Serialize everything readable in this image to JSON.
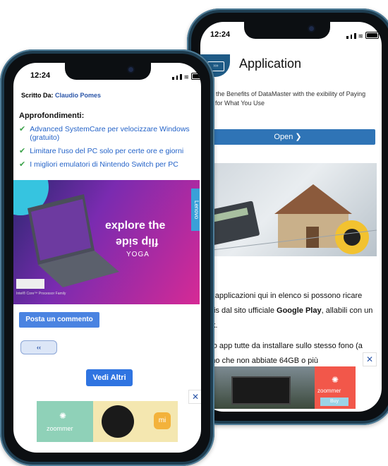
{
  "back_phone": {
    "time": "12:24",
    "app_title": "Application",
    "app_desc": "et All the Benefits of DataMaster with the exibility of Paying Only for What You Use",
    "open_button": "Open ❯",
    "body_p1_pre": "e le applicazioni qui in elenco si possono ricare gratis dal sito ufficiale ",
    "body_p1_bold": "Google Play",
    "body_p1_post": ", allabili con un click.",
    "body_p2": "sono app tutte da installare sullo stesso fono (a meno che non abbiate 64GB o più",
    "ad_brand": "zoommer",
    "ad_button": "Buy",
    "close_icon": "✕",
    "logo_glyph": "›››"
  },
  "front_phone": {
    "time": "12:24",
    "author_label": "Scritto Da:",
    "author_name": "Claudio Pomes",
    "heading": "Approfondimenti:",
    "links": [
      "Advanced SystemCare per velocizzare Windows (gratuito)",
      "Limitare l'uso del PC solo per certe ore e giorni",
      "I migliori emulatori di Nintendo Switch per PC"
    ],
    "ad": {
      "headline_1": "explore the",
      "headline_2": "flip side",
      "product": "YOGA",
      "brand": "Lenovo",
      "footnote": "Intel® Core™ Processor Family"
    },
    "comment_button": "Posta un commento",
    "prev_button": "‹‹",
    "more_button": "Vedi Altri",
    "bottom_ad_brand": "zoommer",
    "close_icon": "✕"
  }
}
